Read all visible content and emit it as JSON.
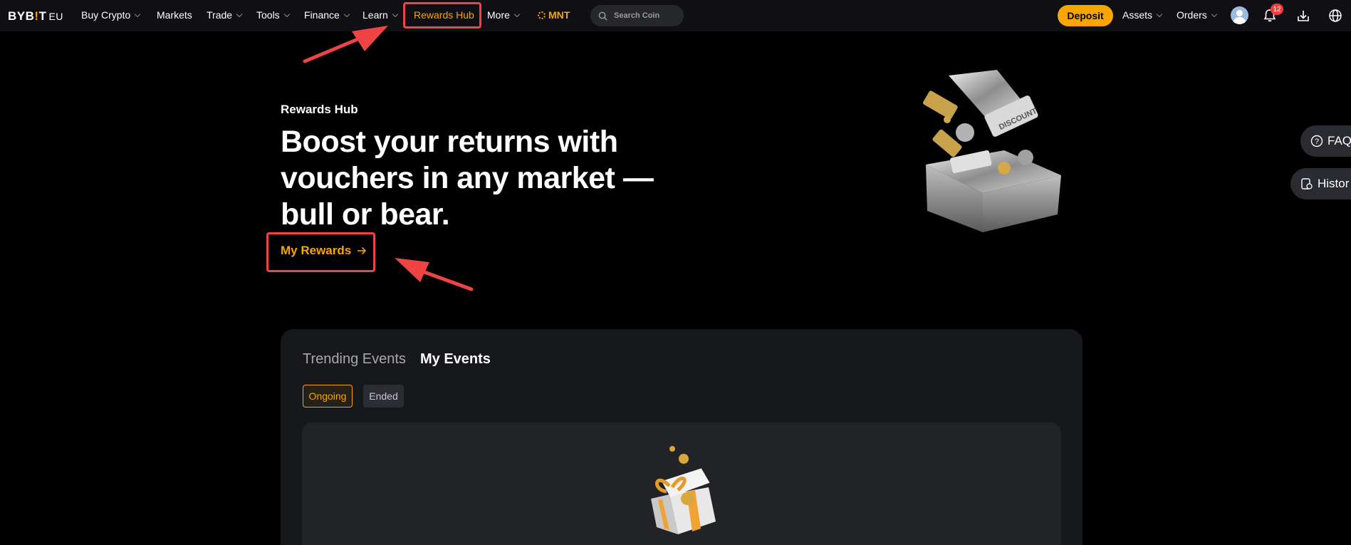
{
  "nav": {
    "logo": {
      "text_a": "BYB",
      "text_b": "!",
      "text_c": "T",
      "suffix": "EU"
    },
    "items": [
      {
        "label": "Buy Crypto"
      },
      {
        "label": "Markets"
      },
      {
        "label": "Trade"
      },
      {
        "label": "Tools"
      },
      {
        "label": "Finance"
      },
      {
        "label": "Learn"
      },
      {
        "label": "Rewards Hub"
      },
      {
        "label": "More"
      }
    ],
    "mnt": "MNT",
    "search_placeholder": "Search Coin",
    "deposit": "Deposit",
    "assets": "Assets",
    "orders": "Orders",
    "notification_count": "12"
  },
  "hero": {
    "subtitle": "Rewards Hub",
    "title": "Boost your returns with vouchers in any market — bull or bear.",
    "my_rewards": "My Rewards"
  },
  "side": {
    "faq": "FAQ",
    "history": "Histor"
  },
  "events": {
    "tabs": [
      "Trending Events",
      "My Events"
    ],
    "filters": [
      "Ongoing",
      "Ended"
    ]
  },
  "colors": {
    "accent": "#f7a600",
    "annotation": "#ef4444",
    "nav_bg": "#101014"
  }
}
